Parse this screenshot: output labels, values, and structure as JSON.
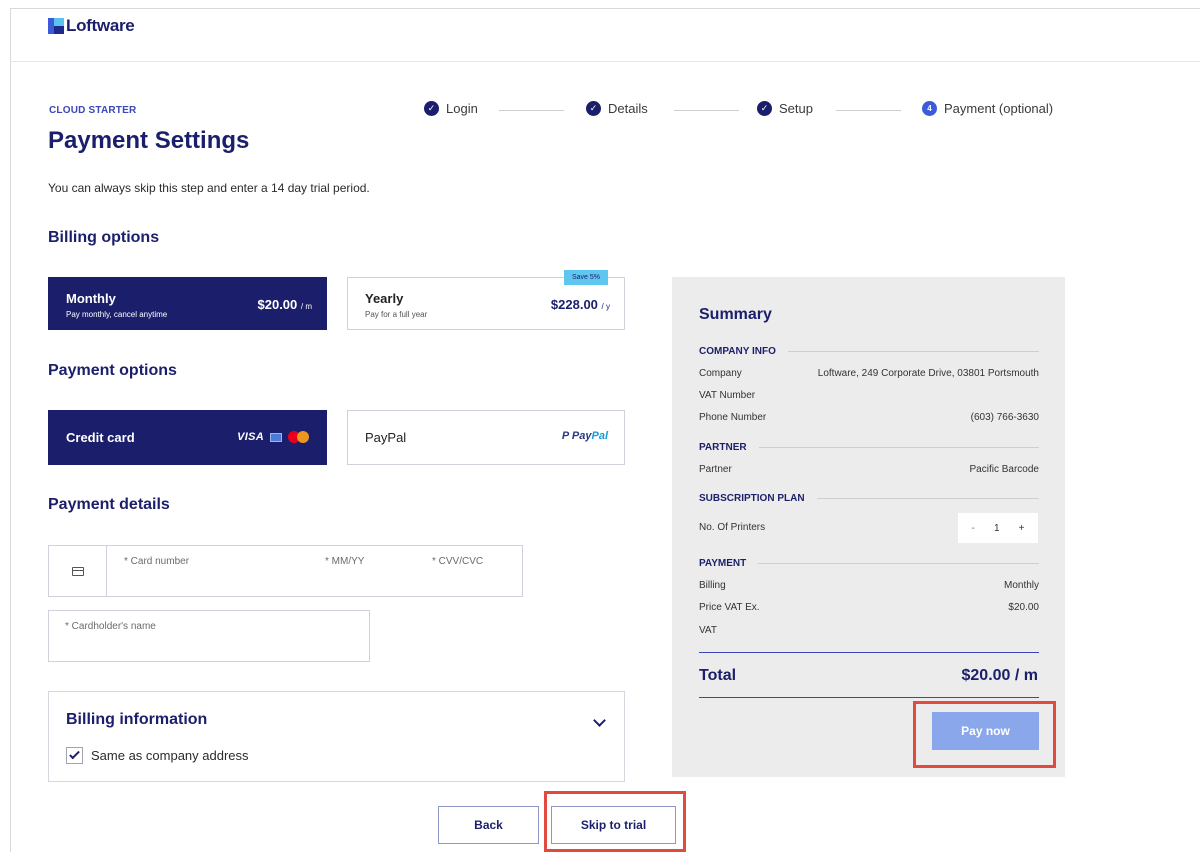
{
  "brand": {
    "name": "Loftware"
  },
  "header": {
    "eyebrow": "CLOUD STARTER",
    "title": "Payment Settings",
    "intro": "You can always skip this step and enter a 14 day trial period."
  },
  "stepper": {
    "steps": [
      {
        "label": "Login",
        "state": "done"
      },
      {
        "label": "Details",
        "state": "done"
      },
      {
        "label": "Setup",
        "state": "done"
      },
      {
        "label": "Payment (optional)",
        "state": "current",
        "number": "4"
      }
    ]
  },
  "billing_options": {
    "title": "Billing options",
    "monthly": {
      "name": "Monthly",
      "sub": "Pay monthly, cancel anytime",
      "price": "$20.00",
      "unit": "/ m",
      "selected": true
    },
    "yearly": {
      "name": "Yearly",
      "sub": "Pay for a full year",
      "price": "$228.00",
      "unit": "/ y",
      "badge": "Save 5%",
      "selected": false
    }
  },
  "payment_options": {
    "title": "Payment options",
    "credit_card": {
      "label": "Credit card",
      "visa": "VISA",
      "selected": true
    },
    "paypal": {
      "label": "PayPal",
      "logo_main": "Pay",
      "logo_accent": "Pal",
      "selected": false
    }
  },
  "payment_details": {
    "title": "Payment details",
    "card_number_placeholder": "* Card number",
    "expiry_placeholder": "* MM/YY",
    "cvv_placeholder": "* CVV/CVC",
    "cardholder_placeholder": "* Cardholder's name"
  },
  "billing_information": {
    "title": "Billing information",
    "same_as_company_label": "Same as company address",
    "same_as_company_checked": true
  },
  "summary": {
    "title": "Summary",
    "company_info": {
      "heading": "COMPANY INFO",
      "company_label": "Company",
      "company_value": "Loftware, 249 Corporate Drive, 03801 Portsmouth",
      "vat_label": "VAT Number",
      "vat_value": "",
      "phone_label": "Phone Number",
      "phone_value": "(603) 766-3630"
    },
    "partner": {
      "heading": "PARTNER",
      "partner_label": "Partner",
      "partner_value": "Pacific Barcode"
    },
    "subscription": {
      "heading": "SUBSCRIPTION PLAN",
      "printers_label": "No. Of Printers",
      "minus": "-",
      "qty": "1",
      "plus": "+"
    },
    "payment": {
      "heading": "PAYMENT",
      "billing_label": "Billing",
      "billing_value": "Monthly",
      "price_label": "Price VAT Ex.",
      "price_value": "$20.00",
      "vat_label": "VAT",
      "vat_value": ""
    },
    "total_label": "Total",
    "total_value": "$20.00 / m",
    "pay_button": "Pay now"
  },
  "footer": {
    "back_button": "Back",
    "skip_button": "Skip to trial"
  },
  "colors": {
    "brand_navy": "#1b1f6b",
    "accent_blue": "#3b5bdb",
    "badge_cyan": "#5ec6ef",
    "pay_button": "#8aa7ec",
    "highlight_red": "#e04a3f",
    "summary_bg": "#ececec"
  }
}
